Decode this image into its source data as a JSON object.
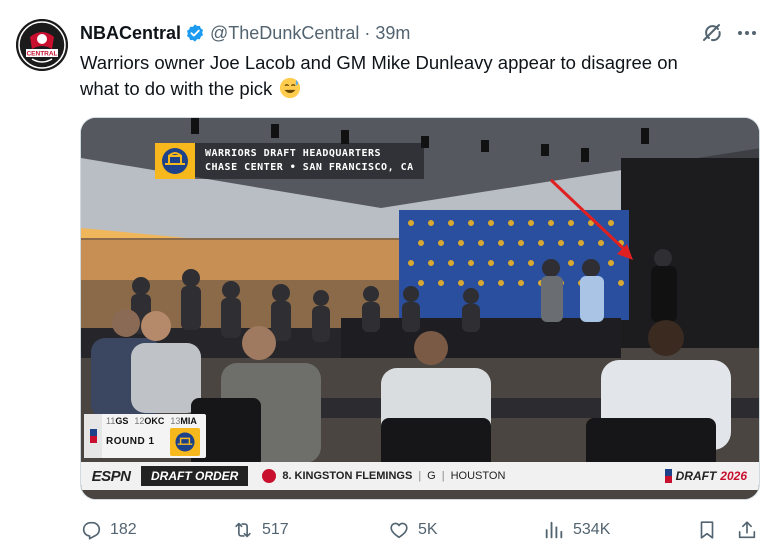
{
  "author": {
    "display_name": "NBACentral",
    "handle": "@TheDunkCentral",
    "separator": "·",
    "time": "39m",
    "verified": true,
    "avatar_text": "CENTRAL"
  },
  "tweet": {
    "text_line1": "Warriors owner Joe Lacob and GM Mike Dunleavy appear to disagree on",
    "text_line2": "what to do with the pick",
    "emoji": "sweat-smile-emoji"
  },
  "media": {
    "overlay_title_line1": "WARRIORS DRAFT HEADQUARTERS",
    "overlay_title_line2": "CHASE CENTER • SAN FRANCISCO, CA",
    "scorebug": {
      "picks": [
        {
          "num": "11",
          "team": "GS"
        },
        {
          "num": "12",
          "team": "OKC"
        },
        {
          "num": "13",
          "team": "MIA"
        }
      ],
      "round_label": "ROUND 1"
    },
    "ticker": {
      "network": "ESPN",
      "label": "DRAFT ORDER",
      "pick_text": "8. KINGSTON FLEMINGS",
      "position": "G",
      "school": "HOUSTON",
      "bar_separator": "|",
      "brand_prefix": "DRAFT",
      "brand_year": "2026"
    },
    "annotation": "red-arrow-pointing-at-person"
  },
  "actions": {
    "replies": "182",
    "reposts": "517",
    "likes": "5K",
    "views": "534K"
  },
  "colors": {
    "text_primary": "#0f1419",
    "text_secondary": "#536471",
    "verified_blue": "#1d9bf0",
    "warriors_gold": "#f7b81d",
    "warriors_blue": "#1d428a",
    "arrow_red": "#e02020"
  }
}
